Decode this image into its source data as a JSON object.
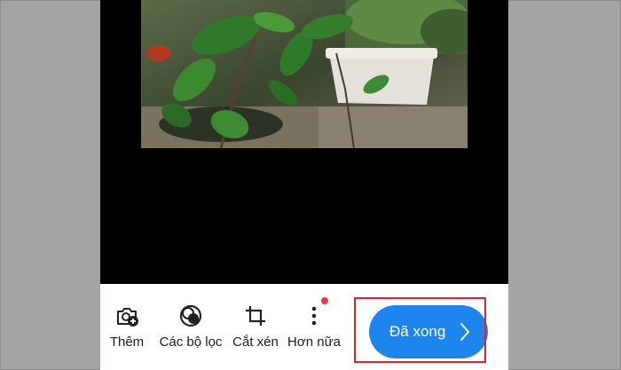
{
  "toolbar": {
    "items": [
      {
        "label": "Thêm",
        "icon": "add-photo-icon"
      },
      {
        "label": "Các bộ lọc",
        "icon": "filters-icon"
      },
      {
        "label": "Cắt xén",
        "icon": "crop-icon"
      },
      {
        "label": "Hơn nữa",
        "icon": "more-vert-icon",
        "badge": "notification-dot"
      }
    ],
    "done_label": "Đã xong",
    "done_icon": "chevron-right-icon"
  },
  "colors": {
    "accent": "#1f85ee",
    "badge": "#e53945",
    "highlight": "#d9262c"
  }
}
